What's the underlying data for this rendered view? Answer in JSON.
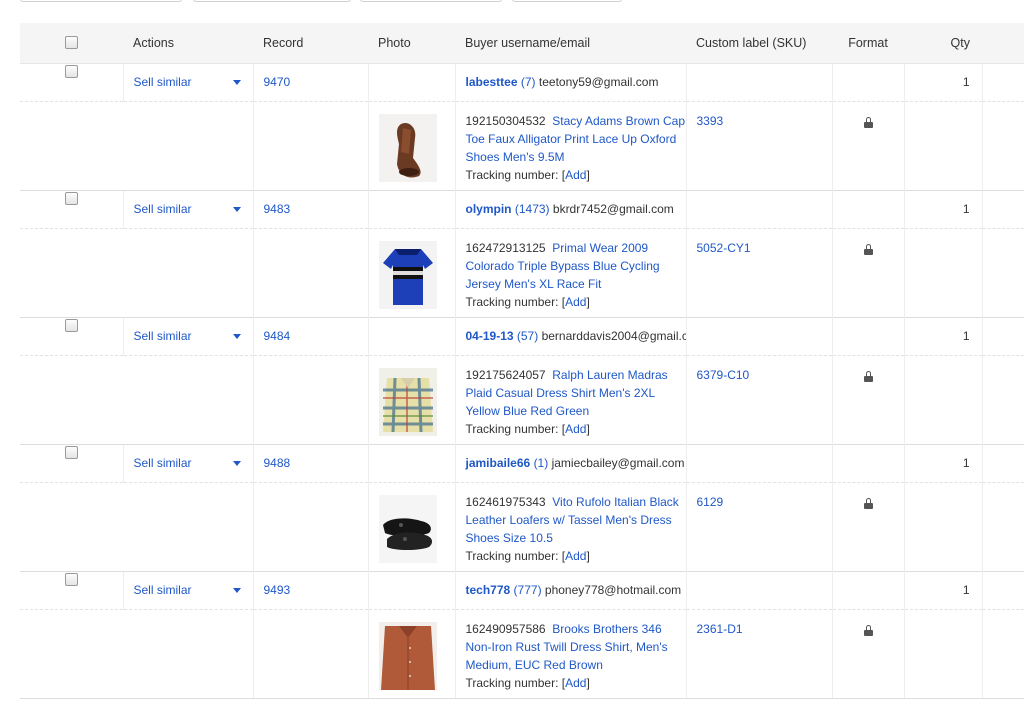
{
  "columns": {
    "actions": "Actions",
    "record": "Record",
    "photo": "Photo",
    "buyer": "Buyer username/email",
    "sku": "Custom label (SKU)",
    "format": "Format",
    "qty": "Qty"
  },
  "tracking_label": "Tracking number:",
  "tracking_add": "Add",
  "orders": [
    {
      "action": "Sell similar",
      "record": "9470",
      "buyer_username": "labesttee",
      "feedback": "(7)",
      "email": "teetony59@gmail.com",
      "qty": "1",
      "item_number": "192150304532",
      "title": "Stacy Adams Brown Cap Toe Faux Alligator Print Lace Up Oxford Shoes Men's 9.5M",
      "sku": "3393",
      "photo_icon": "brown-oxford-shoe-thumbnail"
    },
    {
      "action": "Sell similar",
      "record": "9483",
      "buyer_username": "olympin",
      "feedback": "(1473)",
      "email": "bkrdr7452@gmail.com",
      "qty": "1",
      "item_number": "162472913125",
      "title": "Primal Wear 2009 Colorado Triple Bypass Blue Cycling Jersey Men's XL Race Fit",
      "sku": "5052-CY1",
      "photo_icon": "blue-cycling-jersey-thumbnail"
    },
    {
      "action": "Sell similar",
      "record": "9484",
      "buyer_username": "04-19-13",
      "feedback": "(57)",
      "email": "bernarddavis2004@gmail.c",
      "qty": "1",
      "item_number": "192175624057",
      "title": "Ralph Lauren Madras Plaid Casual Dress Shirt Men's 2XL Yellow Blue Red Green",
      "sku": "6379-C10",
      "photo_icon": "plaid-shirt-thumbnail"
    },
    {
      "action": "Sell similar",
      "record": "9488",
      "buyer_username": "jamibaile66",
      "feedback": "(1)",
      "email": "jamiecbailey@gmail.com",
      "qty": "1",
      "item_number": "162461975343",
      "title": "Vito Rufolo Italian Black Leather Loafers w/ Tassel Men's Dress Shoes Size 10.5",
      "sku": "6129",
      "photo_icon": "black-loafers-thumbnail"
    },
    {
      "action": "Sell similar",
      "record": "9493",
      "buyer_username": "tech778",
      "feedback": "(777)",
      "email": "phoney778@hotmail.com",
      "qty": "1",
      "item_number": "162490957586",
      "title": "Brooks Brothers 346 Non-Iron Rust Twill Dress Shirt, Men's Medium, EUC Red Brown",
      "sku": "2361-D1",
      "photo_icon": "rust-dress-shirt-thumbnail"
    }
  ]
}
